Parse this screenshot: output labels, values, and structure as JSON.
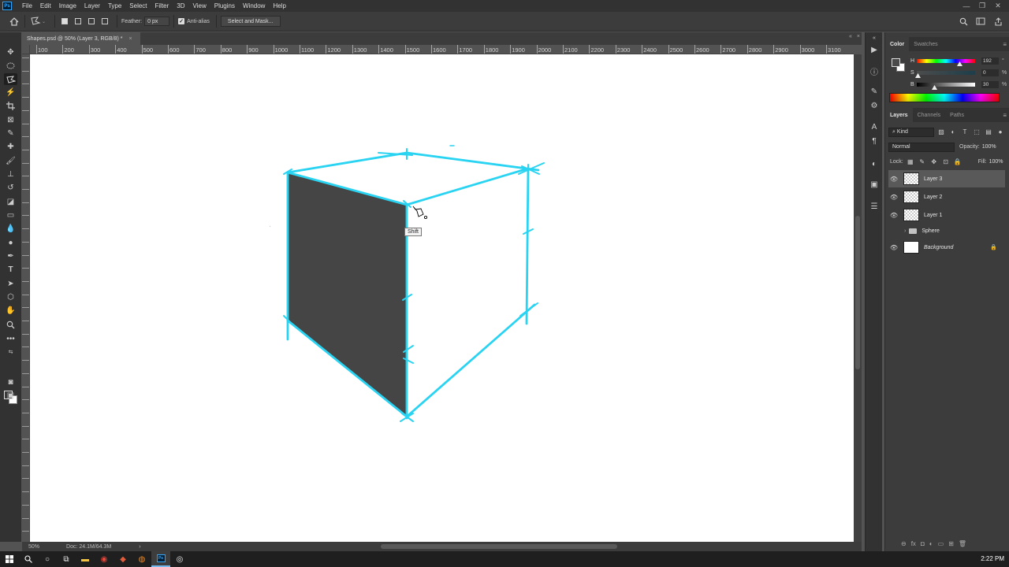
{
  "app": {
    "logo_text": "Ps"
  },
  "menu": [
    "File",
    "Edit",
    "Image",
    "Layer",
    "Type",
    "Select",
    "Filter",
    "3D",
    "View",
    "Plugins",
    "Window",
    "Help"
  ],
  "window_controls": [
    "—",
    "❐",
    "✕"
  ],
  "options": {
    "feather_label": "Feather:",
    "feather_value": "0 px",
    "antialias_label": "Anti-alias",
    "select_mask_label": "Select and Mask..."
  },
  "document": {
    "tab_title": "Shapes.psd @ 50% (Layer 3, RGB/8) *",
    "close_symbol": "×"
  },
  "ruler": {
    "labels": [
      "100",
      "200",
      "300",
      "400",
      "500",
      "600",
      "700",
      "800",
      "900",
      "1000",
      "1100",
      "1200",
      "1300",
      "1400",
      "1500",
      "1600",
      "1700",
      "1800",
      "1900",
      "2000",
      "2100",
      "2200",
      "2300",
      "2400",
      "2500",
      "2600",
      "2700",
      "2800",
      "2900",
      "3000",
      "3100"
    ]
  },
  "canvas": {
    "tooltip": "Shift",
    "stroke_color": "#29d3f2",
    "face_color": "#454545"
  },
  "status": {
    "zoom": "50%",
    "doc_size": "Doc: 24.1M/64.3M",
    "arrow": "›"
  },
  "color_panel": {
    "tabs": [
      "Color",
      "Swatches"
    ],
    "sliders": [
      {
        "letter": "H",
        "value": "192",
        "unit": "°"
      },
      {
        "letter": "S",
        "value": "0",
        "unit": "%"
      },
      {
        "letter": "B",
        "value": "30",
        "unit": "%"
      }
    ]
  },
  "layers_panel": {
    "tabs": [
      "Layers",
      "Channels",
      "Paths"
    ],
    "filter_kind": "Kind",
    "blend_mode": "Normal",
    "opacity_label": "Opacity:",
    "opacity_value": "100%",
    "lock_label": "Lock:",
    "fill_label": "Fill:",
    "fill_value": "100%",
    "layers": [
      {
        "name": "Layer 3",
        "visible": true,
        "selected": true,
        "type": "pixel"
      },
      {
        "name": "Layer 2",
        "visible": true,
        "selected": false,
        "type": "pixel"
      },
      {
        "name": "Layer 1",
        "visible": true,
        "selected": false,
        "type": "pixel"
      },
      {
        "name": "Sphere",
        "visible": false,
        "selected": false,
        "type": "group"
      },
      {
        "name": "Background",
        "visible": true,
        "selected": false,
        "type": "background"
      }
    ]
  },
  "taskbar": {
    "time": "2:22 PM"
  }
}
